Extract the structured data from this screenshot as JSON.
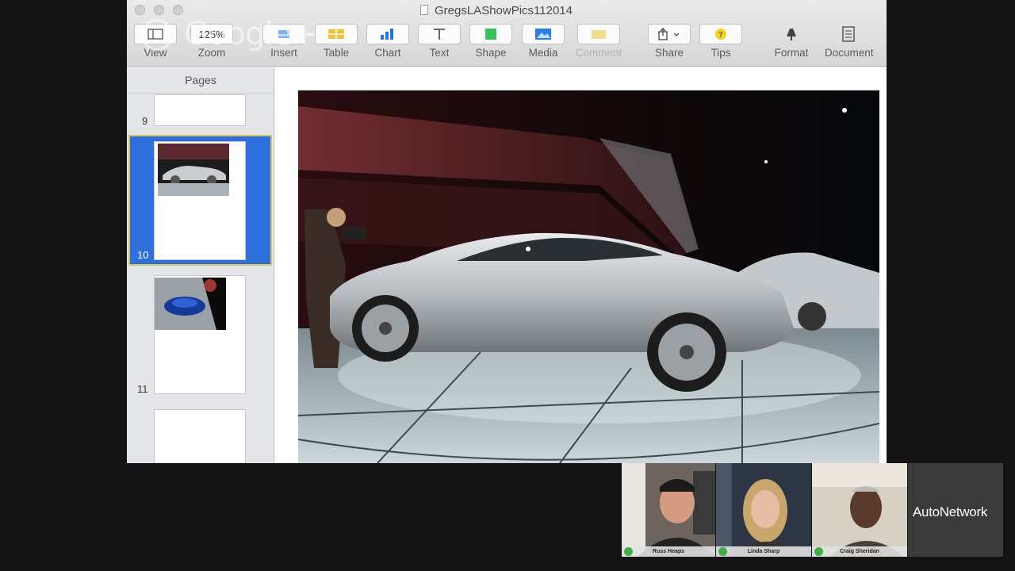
{
  "window": {
    "title": "GregsLASho‌wPics112014"
  },
  "toolbar": {
    "view": {
      "label": "View"
    },
    "zoom": {
      "value": "125%",
      "label": "Zoom"
    },
    "insert": {
      "label": "Insert"
    },
    "table": {
      "label": "Table"
    },
    "chart": {
      "label": "Chart"
    },
    "text": {
      "label": "Text"
    },
    "shape": {
      "label": "Shape"
    },
    "media": {
      "label": "Media"
    },
    "comment": {
      "label": "Comment"
    },
    "share": {
      "label": "Share"
    },
    "tips": {
      "label": "Tips"
    },
    "format": {
      "label": "Format"
    },
    "document": {
      "label": "Document"
    }
  },
  "watermark": {
    "text": "Google+"
  },
  "sidebar": {
    "header": "Pages",
    "pages": [
      {
        "number": "9"
      },
      {
        "number": "10"
      },
      {
        "number": "11"
      }
    ]
  },
  "webcams": {
    "participants": [
      {
        "name": "Russ Heaps"
      },
      {
        "name": "Linda Sharp"
      },
      {
        "name": "Craig Sheridan"
      }
    ],
    "brand": "AutoNetwork"
  },
  "colors": {
    "selection": "#2e6fdc",
    "selection_border": "#d4c45a",
    "shape_icon": "#36c35a",
    "accent_blue": "#1e78e0",
    "tips_yellow": "#f5d21b"
  }
}
